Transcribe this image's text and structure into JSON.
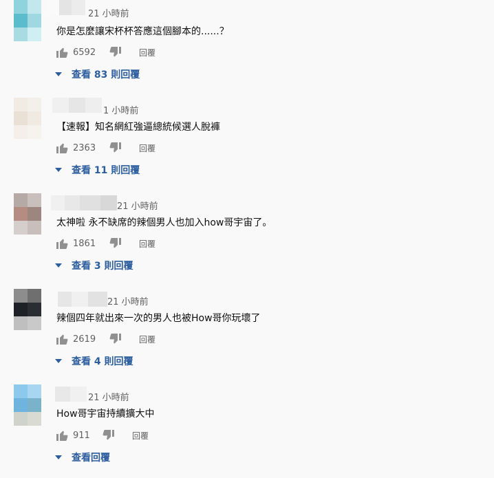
{
  "comments": [
    {
      "time": "21 小時前",
      "text": "你是怎麼讓宋杯杯答應這個腳本的......？",
      "likes": "6592",
      "reply": "回覆",
      "view_replies": "查看 83 則回覆",
      "avatar_colors": [
        "#8fd3dc",
        "#c2e8ee",
        "#5bbccb",
        "#9fd8e0",
        "#a9dbe3",
        "#cfeff3"
      ]
    },
    {
      "time": "1 小時前",
      "text": "【速報】知名網紅強逼總統候選人脫褲",
      "likes": "2363",
      "reply": "回覆",
      "view_replies": "查看 11 則回覆",
      "avatar_colors": [
        "#f1ebe4",
        "#f3efea",
        "#e9e0d6",
        "#f1eae3",
        "#f4efea",
        "#f6f2ee"
      ]
    },
    {
      "time": "21 小時前",
      "text": "太神啦 永不缺席的辣個男人也加入how哥宇宙了。",
      "likes": "1861",
      "reply": "回覆",
      "view_replies": "查看 3 則回覆",
      "avatar_colors": [
        "#b6aaa7",
        "#c9bfbc",
        "#b48c82",
        "#9c867f",
        "#d6cecc",
        "#c8bfbd"
      ]
    },
    {
      "time": "21 小時前",
      "text": "辣個四年就出來一次的男人也被How哥你玩壞了",
      "likes": "2619",
      "reply": "回覆",
      "view_replies": "查看 4 則回覆",
      "avatar_colors": [
        "#8d8d8d",
        "#6f6f6f",
        "#1e2226",
        "#2a2e33",
        "#bfbfbf",
        "#c9c9c9"
      ]
    },
    {
      "time": "21 小時前",
      "text": "How哥宇宙持續擴大中",
      "likes": "911",
      "reply": "回覆",
      "view_replies": "查看回覆",
      "avatar_colors": [
        "#8cc9ec",
        "#a8d6f0",
        "#6eb4de",
        "#7ab2c9",
        "#cfd3cc",
        "#d9dad2"
      ]
    }
  ],
  "colors": {
    "accent": "#065fd4",
    "secondary_text": "#606060",
    "background": "#f9f9f9"
  }
}
